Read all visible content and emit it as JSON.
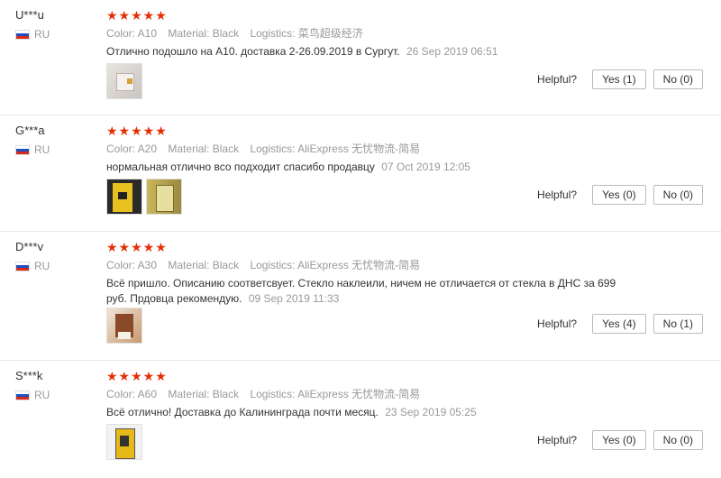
{
  "labels": {
    "helpful": "Helpful?",
    "stars": "★★★★★"
  },
  "reviews": [
    {
      "user": "U***u",
      "country": "RU",
      "color": "Color: A10",
      "material": "Material: Black",
      "logistics": "Logistics: 菜鸟超级经济",
      "text": "Отлично подошло на А10. доставка 2-26.09.2019 в Сургут.",
      "date": "26 Sep 2019 06:51",
      "yes": "Yes (1)",
      "no": "No (0)"
    },
    {
      "user": "G***a",
      "country": "RU",
      "color": "Color: A20",
      "material": "Material: Black",
      "logistics": "Logistics: AliExpress 无忧物流-简易",
      "text": "нормальная отлично всо подходит спасибо продавцу",
      "date": "07 Oct 2019 12:05",
      "yes": "Yes (0)",
      "no": "No (0)"
    },
    {
      "user": "D***v",
      "country": "RU",
      "color": "Color: A30",
      "material": "Material: Black",
      "logistics": "Logistics: AliExpress 无忧物流-简易",
      "text": "Всё пришло. Описанию соответсвует. Стекло наклеили, ничем не отличается от стекла в ДНС за 699 руб. Прдовца рекомендую.",
      "date": "09 Sep 2019 11:33",
      "yes": "Yes (4)",
      "no": "No (1)"
    },
    {
      "user": "S***k",
      "country": "RU",
      "color": "Color: A60",
      "material": "Material: Black",
      "logistics": "Logistics: AliExpress 无忧物流-简易",
      "text": "Всё отлично! Доставка до Калининграда почти месяц.",
      "date": "23 Sep 2019 05:25",
      "yes": "Yes (0)",
      "no": "No (0)"
    }
  ]
}
